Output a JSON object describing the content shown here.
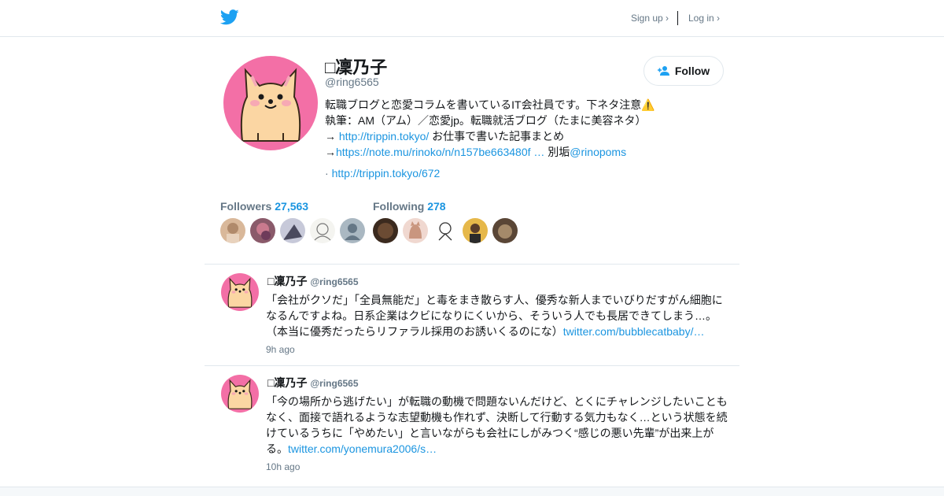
{
  "header": {
    "logo_icon": "twitter-bird-icon",
    "signup_label": "Sign up ›",
    "login_label": "Log in ›",
    "accent_color": "#1da1f2"
  },
  "profile": {
    "name": "□凜乃子",
    "handle": "@ring6565",
    "follow_label": "Follow",
    "bio": {
      "t1": "転職ブログと恋愛コラムを書いているIT会社員です。下ネタ注意",
      "emoji": "⚠️",
      "t2": "執筆：AM（アム）／恋愛jp。転職就活ブログ（たまに美容ネタ）→ ",
      "link1": "http://trippin.tokyo/",
      "t3": "  お仕事で書いた記事まとめ→",
      "link2": "https://note.mu/rinoko/n/n157be663480f …",
      "t4": " 別垢",
      "mention": "@rinopoms"
    },
    "url_prefix": "· ",
    "url": "http://trippin.tokyo/672"
  },
  "stats": {
    "followers_label": "Followers",
    "followers_count": "27,563",
    "following_label": "Following",
    "following_count": "278"
  },
  "tweets": [
    {
      "name": "□凜乃子",
      "handle": "@ring6565",
      "text": "「会社がクソだ」「全員無能だ」と毒をまき散らす人、優秀な新人までいびりだすがん細胞になるんですよね。日系企業はクビになりにくいから、そういう人でも長居できてしまう…。（本当に優秀だったらリファラル採用のお誘いくるのにな）",
      "link": "twitter.com/bubblecatbaby/…",
      "time": "9h ago"
    },
    {
      "name": "□凜乃子",
      "handle": "@ring6565",
      "text": "「今の場所から逃げたい」が転職の動機で問題ないんだけど、とくにチャレンジしたいこともなく、面接で語れるような志望動機も作れず、決断して行動する気力もなく…という状態を続けているうちに「やめたい」と言いながらも会社にしがみつく“感じの悪い先輩”が出来上がる。",
      "link": "twitter.com/yonemura2006/s…",
      "time": "10h ago"
    }
  ]
}
